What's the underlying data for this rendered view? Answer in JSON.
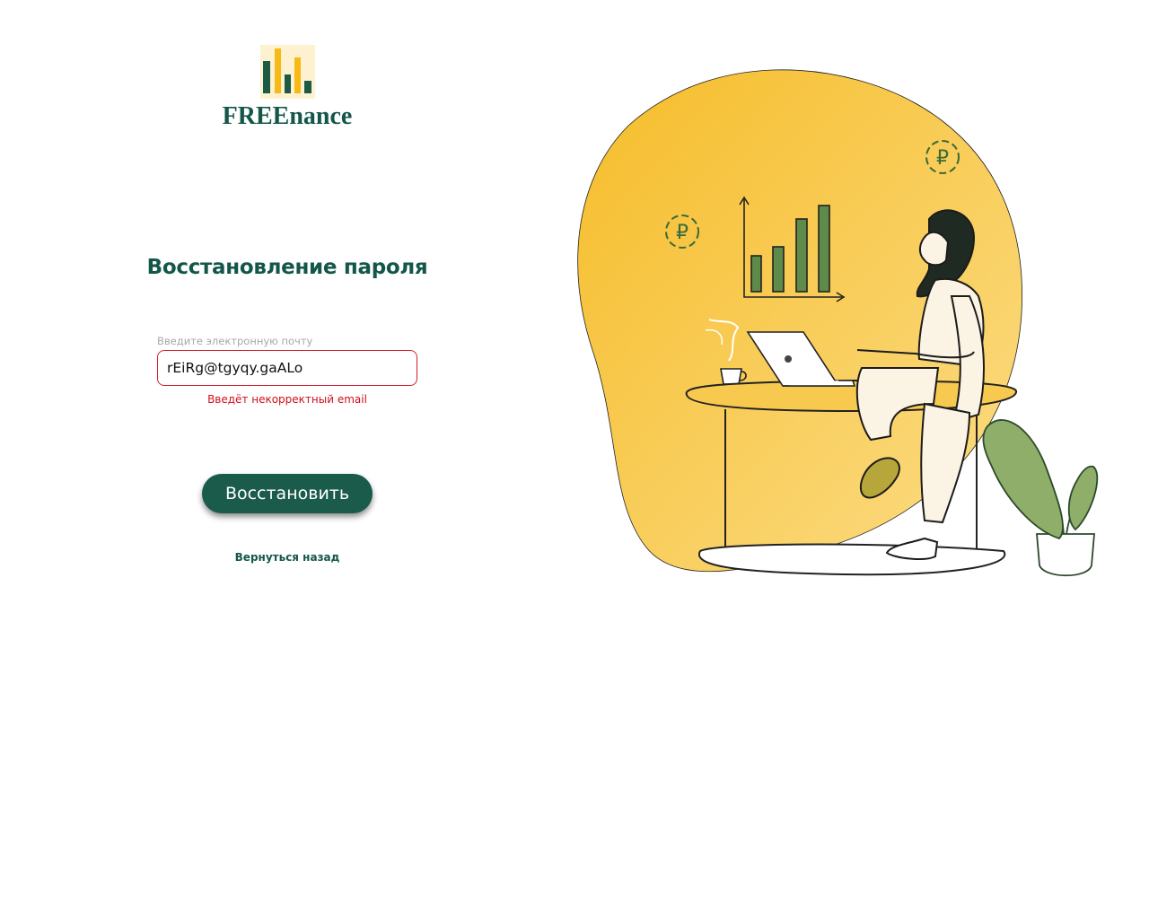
{
  "brand": {
    "name": "FREEnance"
  },
  "form": {
    "title": "Восстановление пароля",
    "email_label": "Введите электронную почту",
    "email_value": "rEiRg@tgyqy.gaALo",
    "error": "Введёт некорректный email",
    "submit_label": "Восстановить",
    "back_label": "Вернуться назад"
  },
  "illustration": {
    "currency_symbol": "₽",
    "icons": [
      "freenance-logo-icon",
      "ruble-coin-icon",
      "bar-chart-icon",
      "laptop-icon",
      "coffee-cup-icon",
      "plant-icon"
    ]
  },
  "colors": {
    "brand_green": "#14574a",
    "button_green": "#1a5b4b",
    "logo_yellow": "#f7b915",
    "blob_yellow": "#f8c544",
    "error_red": "#d00f1a"
  }
}
